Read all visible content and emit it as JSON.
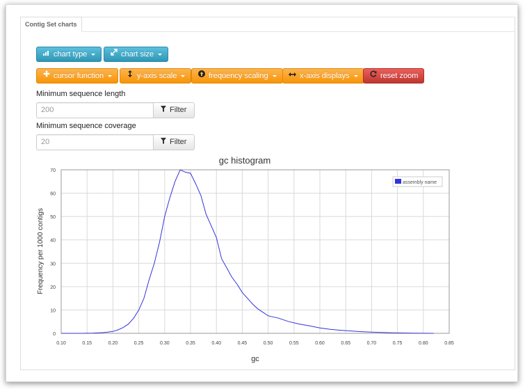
{
  "tab": {
    "label": "Contig Set charts"
  },
  "toolbar_row1": [
    {
      "label": "chart type",
      "icon": "bar-chart-icon"
    },
    {
      "label": "chart size",
      "icon": "resize-icon"
    }
  ],
  "toolbar_row2": [
    {
      "label": "cursor function",
      "icon": "move-icon"
    },
    {
      "label": "y-axis scale",
      "icon": "vertical-arrows-icon"
    },
    {
      "label": "frequency scaling",
      "icon": "circle-arrow-icon"
    },
    {
      "label": "x-axis displays",
      "icon": "horizontal-arrows-icon"
    },
    {
      "label": "reset zoom",
      "icon": "refresh-icon"
    }
  ],
  "filters": {
    "length": {
      "label": "Minimum sequence length",
      "value": "200",
      "button": "Filter"
    },
    "coverage": {
      "label": "Minimum sequence coverage",
      "value": "20",
      "button": "Filter"
    }
  },
  "colors": {
    "line": "#3333dd",
    "grid": "#d9d9d9"
  },
  "chart_data": {
    "type": "line",
    "title": "gc histogram",
    "xlabel": "gc",
    "ylabel": "Frequency per 1000 contigs",
    "xlim": [
      0.1,
      0.85
    ],
    "ylim": [
      0,
      70
    ],
    "xticks": [
      "0.10",
      "0.15",
      "0.20",
      "0.25",
      "0.30",
      "0.35",
      "0.40",
      "0.45",
      "0.50",
      "0.55",
      "0.60",
      "0.65",
      "0.70",
      "0.75",
      "0.80",
      "0.85"
    ],
    "yticks": [
      "0",
      "10",
      "20",
      "30",
      "40",
      "50",
      "60",
      "70"
    ],
    "legend_position": "top-right",
    "series": [
      {
        "name": "assembly name",
        "x": [
          0.1,
          0.12,
          0.14,
          0.16,
          0.18,
          0.19,
          0.2,
          0.21,
          0.22,
          0.23,
          0.24,
          0.25,
          0.26,
          0.27,
          0.28,
          0.29,
          0.3,
          0.31,
          0.32,
          0.33,
          0.34,
          0.35,
          0.36,
          0.37,
          0.38,
          0.39,
          0.4,
          0.41,
          0.42,
          0.43,
          0.44,
          0.45,
          0.46,
          0.47,
          0.48,
          0.49,
          0.5,
          0.52,
          0.54,
          0.56,
          0.58,
          0.6,
          0.62,
          0.64,
          0.66,
          0.68,
          0.7,
          0.72,
          0.74,
          0.76,
          0.78,
          0.8,
          0.82
        ],
        "y": [
          0,
          0,
          0,
          0.1,
          0.3,
          0.5,
          0.8,
          1.5,
          2.5,
          4,
          6.5,
          10,
          15,
          23,
          30,
          39,
          50,
          58,
          65,
          70,
          69,
          68.5,
          64,
          59,
          51,
          46,
          41,
          32,
          28,
          24,
          21,
          17.5,
          15,
          12.5,
          10.5,
          9,
          7.5,
          6.5,
          5,
          4,
          3.2,
          2.3,
          1.7,
          1.3,
          1,
          0.7,
          0.5,
          0.35,
          0.25,
          0.15,
          0.08,
          0.03,
          0
        ]
      }
    ]
  }
}
